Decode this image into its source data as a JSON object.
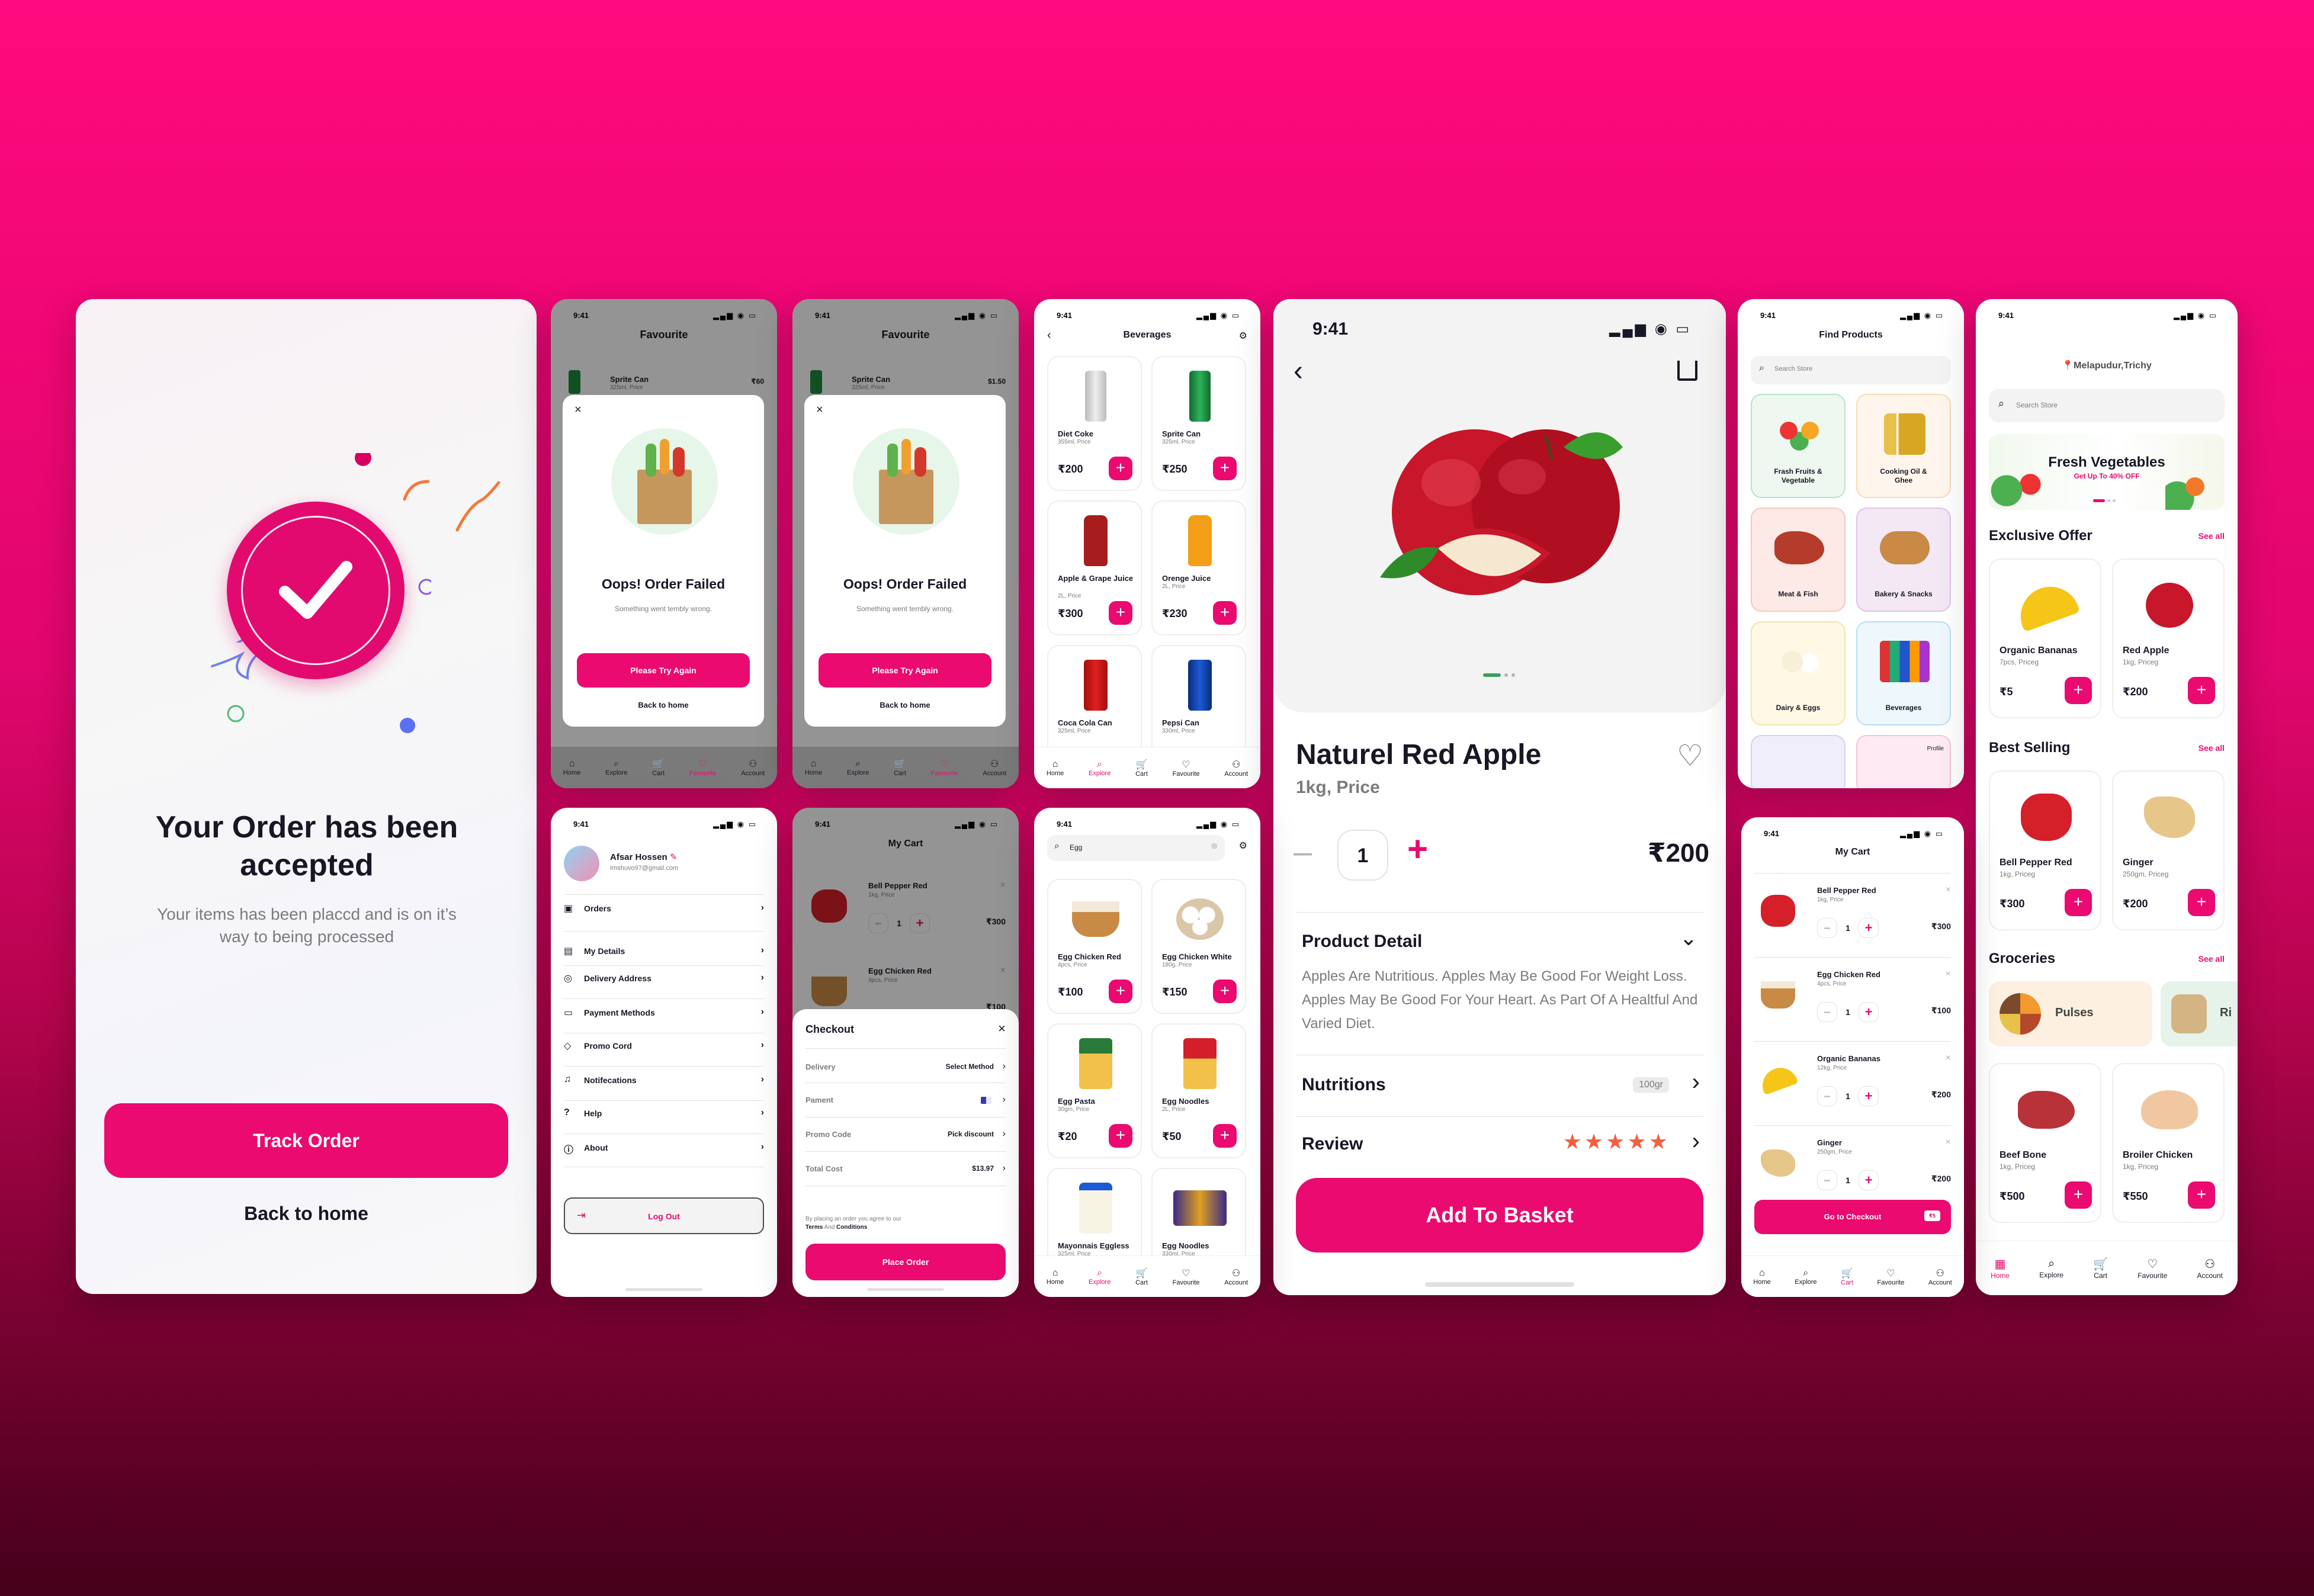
{
  "screen1": {
    "title": "Your Order has been accepted",
    "subtitle": "Your items has been placcd and is on it’s way to being processed",
    "track_btn": "Track Order",
    "back_link": "Back to home"
  },
  "fav_failed": {
    "time": "9:41",
    "title": "Favourite",
    "item_name": "Sprite Can",
    "item_sub": "325ml, Price",
    "item_price_a": "₹60",
    "item_price_b": "$1.50",
    "dialog_title": "Oops! Order Failed",
    "dialog_sub": "Something went tembly wrong.",
    "try_btn": "Please Try Again",
    "back": "Back to home"
  },
  "nav": {
    "home": "Home",
    "explore": "Explore",
    "cart": "Cart",
    "favourite": "Favourite",
    "account": "Account"
  },
  "beverages": {
    "time": "9:41",
    "title": "Beverages",
    "items": [
      {
        "name": "Diet Coke",
        "sub": "355ml, Price",
        "price": "₹200"
      },
      {
        "name": "Sprite Can",
        "sub": "325ml, Price",
        "price": "₹250"
      },
      {
        "name": "Apple & Grape Juice",
        "sub": "2L, Price",
        "price": "₹300"
      },
      {
        "name": "Orenge Juice",
        "sub": "2L, Price",
        "price": "₹230"
      },
      {
        "name": "Coca Cola Can",
        "sub": "325ml, Price",
        "price": ""
      },
      {
        "name": "Pepsi Can",
        "sub": "330ml, Price",
        "price": ""
      }
    ]
  },
  "detail": {
    "time": "9:41",
    "name": "Naturel Red Apple",
    "sub": "1kg, Price",
    "qty": "1",
    "price": "₹200",
    "section_title": "Product Detail",
    "description": "Apples Are Nutritious. Apples May Be Good For Weight Loss. Apples May Be Good For Your Heart. As Part Of A Healtful And Varied Diet.",
    "nutritions": "Nutritions",
    "nutrition_badge": "100gr",
    "review": "Review",
    "rating": 5,
    "add_btn": "Add To Basket"
  },
  "find": {
    "time": "9:41",
    "title": "Find Products",
    "search_placeholder": "Search Store",
    "categories": [
      {
        "name": "Frash Fruits & Vegetable"
      },
      {
        "name": "Cooking Oil & Ghee"
      },
      {
        "name": "Meat & Fish"
      },
      {
        "name": "Bakery & Snacks"
      },
      {
        "name": "Dairy & Eggs"
      },
      {
        "name": "Beverages"
      }
    ],
    "tooltip": "Profile"
  },
  "home": {
    "time": "9:41",
    "location": "Melapudur,Trichy",
    "search_placeholder": "Search Store",
    "banner_title": "Fresh Vegetables",
    "banner_sub": "Get Up To 40% OFF",
    "exclusive": "Exclusive Offer",
    "best": "Best Selling",
    "groceries": "Groceries",
    "see_all": "See all",
    "exclusive_items": [
      {
        "name": "Organic Bananas",
        "sub": "7pcs, Priceg",
        "price": "₹5"
      },
      {
        "name": "Red Apple",
        "sub": "1kg, Priceg",
        "price": "₹200"
      }
    ],
    "best_items": [
      {
        "name": "Bell Pepper Red",
        "sub": "1kg, Priceg",
        "price": "₹300"
      },
      {
        "name": "Ginger",
        "sub": "250gm, Priceg",
        "price": "₹200"
      }
    ],
    "grocery_chips": [
      {
        "name": "Pulses"
      },
      {
        "name": "Ri"
      }
    ],
    "grocery_items": [
      {
        "name": "Beef Bone",
        "sub": "1kg, Priceg",
        "price": "₹500"
      },
      {
        "name": "Broiler Chicken",
        "sub": "1kg, Priceg",
        "price": "₹550"
      }
    ]
  },
  "account": {
    "time": "9:41",
    "name": "Afsar Hossen",
    "email": "Imshuvo97@gmail.com",
    "items": [
      "Orders",
      "My Details",
      "Delivery Address",
      "Payment Methods",
      "Promo Cord",
      "Notifecations",
      "Help",
      "About"
    ],
    "logout": "Log Out"
  },
  "checkout": {
    "time": "9:41",
    "title": "My Cart",
    "item1_name": "Bell Pepper Red",
    "item1_sub": "1kg, Price",
    "item1_qty": "1",
    "item1_price": "₹300",
    "item2_name": "Egg Chicken Red",
    "item2_sub": "4pcs, Price",
    "item2_price": "₹100",
    "sheet_title": "Checkout",
    "rows": [
      {
        "label": "Delivery",
        "value": "Select Method"
      },
      {
        "label": "Pament",
        "value": ""
      },
      {
        "label": "Promo Code",
        "value": "Pick discount"
      },
      {
        "label": "Total Cost",
        "value": "$13.97"
      }
    ],
    "terms_a": "By placing an order you agree to our",
    "terms_b": "Terms",
    "terms_c": "And",
    "terms_d": "Conditions",
    "place_btn": "Place Order"
  },
  "search": {
    "time": "9:41",
    "query": "Egg",
    "items": [
      {
        "name": "Egg Chicken Red",
        "sub": "4pcs, Price",
        "price": "₹100"
      },
      {
        "name": "Egg Chicken White",
        "sub": "180g, Price",
        "price": "₹150"
      },
      {
        "name": "Egg Pasta",
        "sub": "30gm, Price",
        "price": "₹20"
      },
      {
        "name": "Egg Noodles",
        "sub": "2L, Price",
        "price": "₹50"
      },
      {
        "name": "Mayonnais Eggless",
        "sub": "325ml, Price",
        "price": ""
      },
      {
        "name": "Egg Noodles",
        "sub": "330ml, Price",
        "price": ""
      }
    ]
  },
  "mycart": {
    "time": "9:41",
    "title": "My Cart",
    "items": [
      {
        "name": "Bell Pepper Red",
        "sub": "1kg, Price",
        "qty": "1",
        "price": "₹300"
      },
      {
        "name": "Egg Chicken Red",
        "sub": "4pcs, Price",
        "qty": "1",
        "price": "₹100"
      },
      {
        "name": "Organic Bananas",
        "sub": "12kg, Price",
        "qty": "1",
        "price": "₹200"
      },
      {
        "name": "Ginger",
        "sub": "250gm, Price",
        "qty": "1",
        "price": "₹200"
      }
    ],
    "checkout_btn": "Go to Checkout",
    "badge": "₹5"
  },
  "colors": {
    "accent": "#ea0a70",
    "text": "#181725",
    "muted": "#7c7c7c"
  }
}
